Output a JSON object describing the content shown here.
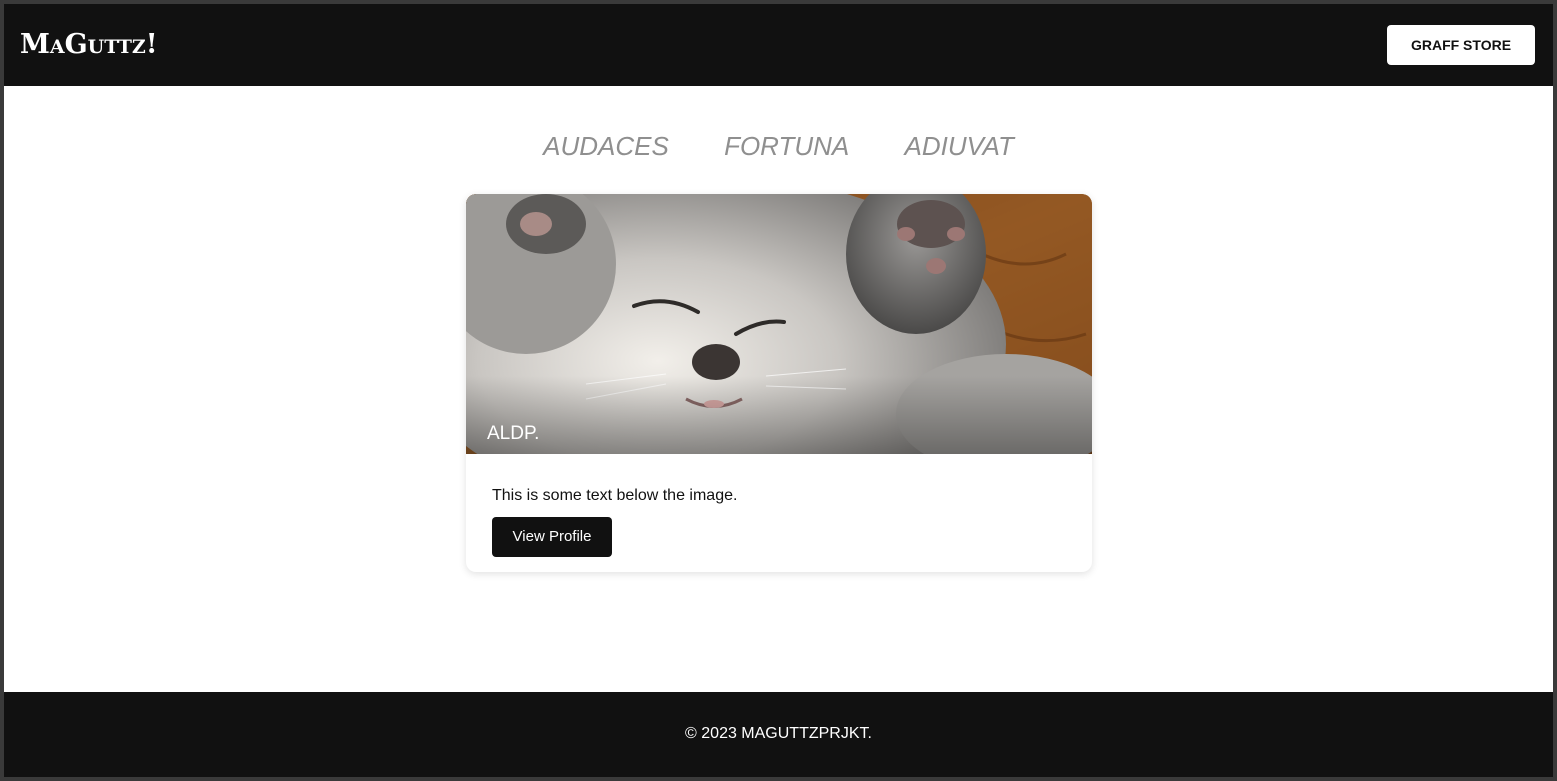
{
  "header": {
    "logo_text": "MaGuttz!",
    "store_button_label": "GRAFF STORE"
  },
  "motto": {
    "words": [
      "AUDACES",
      "FORTUNA",
      "ADIUVAT"
    ]
  },
  "card": {
    "image_alt": "sleeping kitten",
    "overlay_label": "ALDP.",
    "body_text": "This is some text below the image.",
    "button_label": "View Profile"
  },
  "footer": {
    "copyright": "© 2023 MAGUTTZPRJKT."
  },
  "colors": {
    "dark": "#111111",
    "motto_gray": "#8f8f8f",
    "white": "#ffffff"
  }
}
